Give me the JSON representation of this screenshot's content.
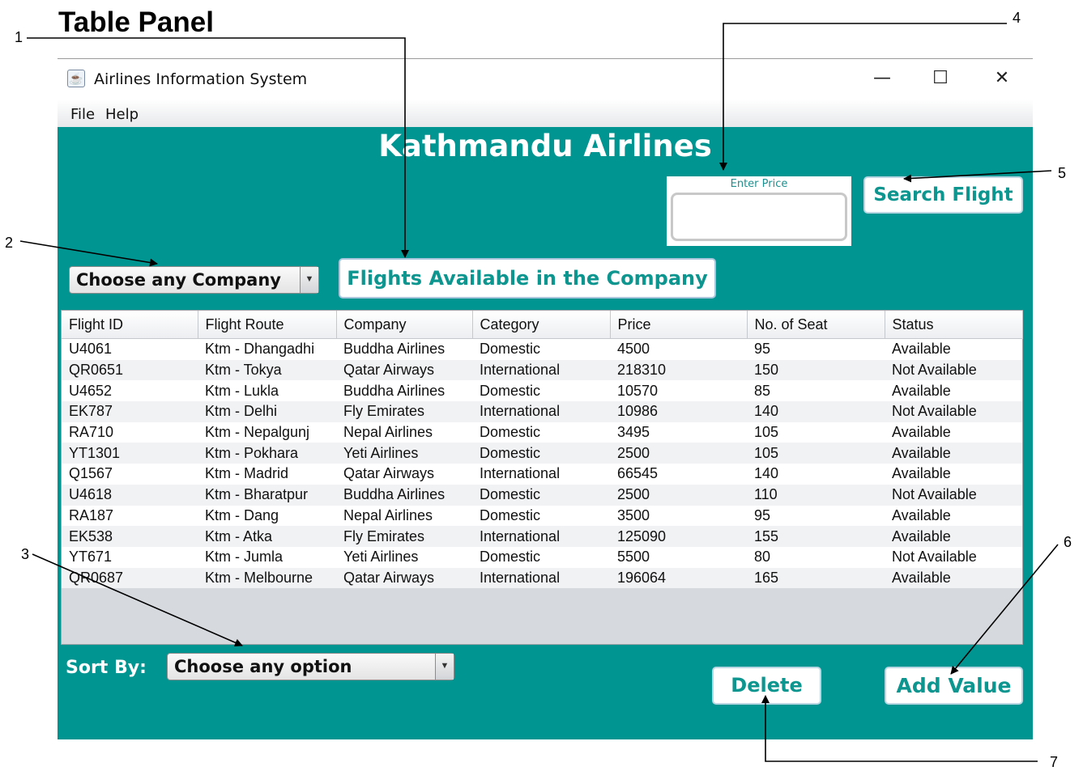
{
  "figure": {
    "title": "Table Panel",
    "callouts": [
      "1",
      "2",
      "3",
      "4",
      "5",
      "6",
      "7"
    ]
  },
  "window": {
    "title": "Airlines Information System",
    "controls": {
      "minimize": "—",
      "maximize": "☐",
      "close": "✕"
    },
    "menu": [
      "File",
      "Help"
    ]
  },
  "main": {
    "heading": "Kathmandu Airlines",
    "price_label": "Enter Price",
    "price_value": "",
    "search_button": "Search Flight",
    "company_combo": "Choose any Company",
    "flights_button": "Flights Available in the Company",
    "sort_label": "Sort By:",
    "sort_combo": "Choose any option",
    "delete_button": "Delete",
    "add_button": "Add Value"
  },
  "table": {
    "columns": [
      "Flight ID",
      "Flight Route",
      "Company",
      "Category",
      "Price",
      "No. of Seat",
      "Status"
    ],
    "rows": [
      [
        "U4061",
        "Ktm - Dhangadhi",
        "Buddha Airlines",
        "Domestic",
        "4500",
        "95",
        "Available"
      ],
      [
        "QR0651",
        "Ktm - Tokya",
        "Qatar Airways",
        "International",
        "218310",
        "150",
        "Not Available"
      ],
      [
        "U4652",
        "Ktm - Lukla",
        "Buddha Airlines",
        "Domestic",
        "10570",
        "85",
        "Available"
      ],
      [
        "EK787",
        "Ktm - Delhi",
        "Fly Emirates",
        "International",
        "10986",
        "140",
        "Not Available"
      ],
      [
        "RA710",
        "Ktm - Nepalgunj",
        "Nepal Airlines",
        "Domestic",
        "3495",
        "105",
        "Available"
      ],
      [
        "YT1301",
        "Ktm - Pokhara",
        "Yeti Airlines",
        "Domestic",
        "2500",
        "105",
        "Available"
      ],
      [
        "Q1567",
        "Ktm - Madrid",
        "Qatar Airways",
        "International",
        "66545",
        "140",
        "Available"
      ],
      [
        "U4618",
        "Ktm - Bharatpur",
        "Buddha Airlines",
        "Domestic",
        "2500",
        "110",
        "Not Available"
      ],
      [
        "RA187",
        "Ktm - Dang",
        "Nepal Airlines",
        "Domestic",
        "3500",
        "95",
        "Available"
      ],
      [
        "EK538",
        "Ktm - Atka",
        "Fly Emirates",
        "International",
        "125090",
        "155",
        "Available"
      ],
      [
        "YT671",
        "Ktm - Jumla",
        "Yeti Airlines",
        "Domestic",
        "5500",
        "80",
        "Not Available"
      ],
      [
        "QR0687",
        "Ktm - Melbourne",
        "Qatar Airways",
        "International",
        "196064",
        "165",
        "Available"
      ]
    ]
  },
  "colors": {
    "background": "#009591",
    "button_text": "#0d9590",
    "heading": "#ffffff"
  }
}
